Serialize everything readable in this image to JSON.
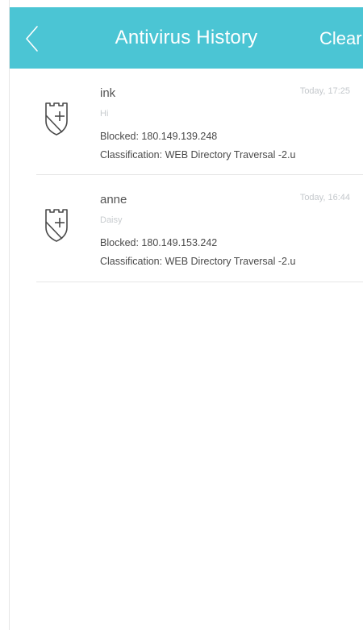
{
  "header": {
    "title": "Antivirus History",
    "clear_label": "Clear",
    "back_icon": "chevron-left-icon",
    "background_color": "#4bc5d4"
  },
  "records": [
    {
      "icon": "shield-castle-icon",
      "name": "ink",
      "time": "Today, 17:25",
      "subtitle": "Hi",
      "blocked": "Blocked: 180.149.139.248",
      "classification": "Classification: WEB Directory Traversal -2.u"
    },
    {
      "icon": "shield-castle-icon",
      "name": "anne",
      "time": "Today, 16:44",
      "subtitle": "Daisy",
      "blocked": "Blocked: 180.149.153.242",
      "classification": "Classification: WEB Directory Traversal -2.u"
    }
  ]
}
